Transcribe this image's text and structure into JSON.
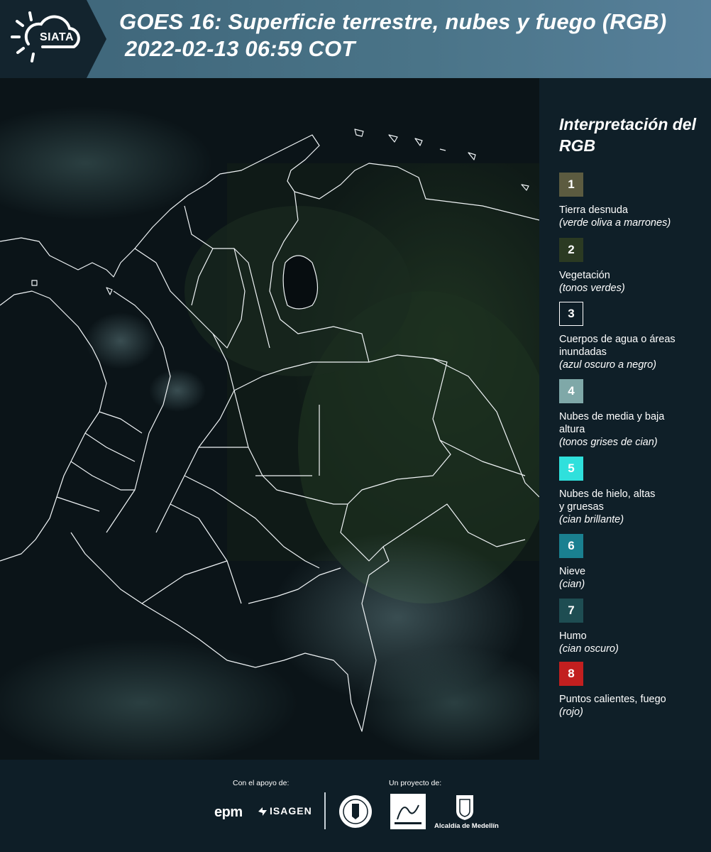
{
  "header": {
    "logo_text": "SIATA",
    "title_line1": "GOES 16: Superficie terrestre, nubes y fuego (RGB)",
    "title_line2": "2022-02-13 06:59 COT"
  },
  "legend": {
    "title": "Interpretación del RGB",
    "items": [
      {
        "number": "1",
        "label": "Tierra desnuda",
        "sub": "(verde oliva a marrones)",
        "color": "#5c5b40"
      },
      {
        "number": "2",
        "label": "Vegetación",
        "sub": "(tonos verdes)",
        "color": "#2b3a22"
      },
      {
        "number": "3",
        "label": "Cuerpos de agua o áreas inundadas",
        "sub": "(azul oscuro a negro)",
        "color": "#0e1e27"
      },
      {
        "number": "4",
        "label": "Nubes de media y baja altura",
        "sub": "(tonos grises de cian)",
        "color": "#7fa8a8"
      },
      {
        "number": "5",
        "label": "Nubes de hielo, altas y gruesas",
        "sub": "(cian brillante)",
        "color": "#2fe0dc"
      },
      {
        "number": "6",
        "label": "Nieve",
        "sub": "(cian)",
        "color": "#1a8090"
      },
      {
        "number": "7",
        "label": "Humo",
        "sub": "(cian oscuro)",
        "color": "#1e4d52"
      },
      {
        "number": "8",
        "label": "Puntos calientes, fuego",
        "sub": "(rojo)",
        "color": "#c21f1f"
      }
    ]
  },
  "footer": {
    "support_caption": "Con el apoyo de:",
    "project_caption": "Un proyecto de:",
    "sponsor_epm": "epm",
    "sponsor_isagen": "ISAGEN",
    "partner_alcaldia": "Alcaldía de Medellín"
  }
}
